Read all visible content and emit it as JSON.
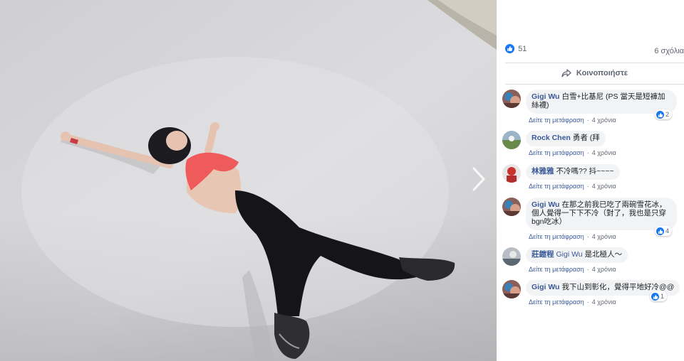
{
  "post": {
    "like_count": "51",
    "comments_count": "6 σχόλια",
    "share_label": "Κοινοποιήστε",
    "colors": {
      "link": "#385898",
      "like": "#1877f2",
      "muted": "#606770"
    }
  },
  "comments": [
    {
      "author": "Gigi Wu",
      "text": "白雪+比基尼 (PS 當天是短褲加絲襪)",
      "translate": "Δείτε τη μετάφραση",
      "time": "4 χρόνια",
      "reactions": "2"
    },
    {
      "author": "Rock Chen",
      "text": "勇者 (拜",
      "translate": "Δείτε τη μετάφραση",
      "time": "4 χρόνια"
    },
    {
      "author": "林雅雅",
      "text": "不冷嗎?? 抖~~~~",
      "translate": "Δείτε τη μετάφραση",
      "time": "4 χρόνια"
    },
    {
      "author": "Gigi Wu",
      "text": "在那之前我已吃了兩碗雪花冰，個人覺得一下下不冷（對了，我也是只穿bgn吃冰）",
      "translate": "Δείτε τη μετάφραση",
      "time": "4 χρόνια",
      "reactions": "4"
    },
    {
      "author": "莊鎧程",
      "mention": "Gigi Wu",
      "text": "是北極人～",
      "translate": "Δείτε τη μετάφραση",
      "time": "4 χρόνια"
    },
    {
      "author": "Gigi Wu",
      "text": "我下山到彰化，覺得平地好冷@@",
      "translate": "Δείτε τη μετάφραση",
      "time": "4 χρόνια",
      "reactions": "1"
    }
  ]
}
